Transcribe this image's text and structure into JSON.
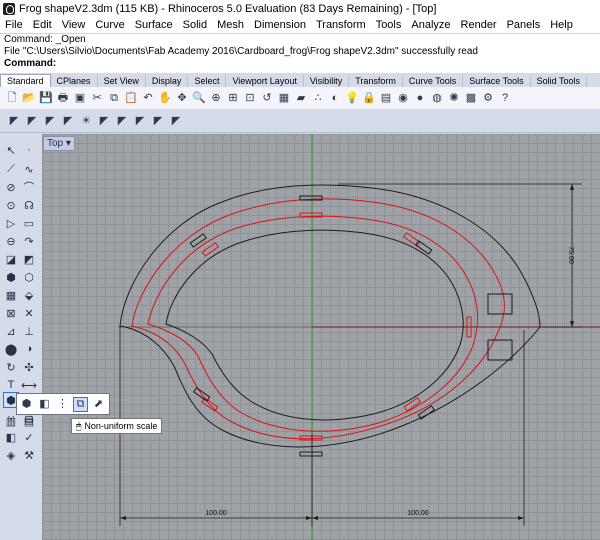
{
  "window": {
    "title": "Frog shapeV2.3dm (115 KB) - Rhinoceros 5.0 Evaluation (83 Days Remaining) - [Top]"
  },
  "menu": [
    "File",
    "Edit",
    "View",
    "Curve",
    "Surface",
    "Solid",
    "Mesh",
    "Dimension",
    "Transform",
    "Tools",
    "Analyze",
    "Render",
    "Panels",
    "Help"
  ],
  "command_history": [
    "Command: _Open",
    "File \"C:\\Users\\Silvio\\Documents\\Fab Academy 2016\\Cardboard_frog\\Frog shapeV2.3dm\" successfully read"
  ],
  "command_prompt": "Command:",
  "toolbar_tabs": [
    "Standard",
    "CPlanes",
    "Set View",
    "Display",
    "Select",
    "Viewport Layout",
    "Visibility",
    "Transform",
    "Curve Tools",
    "Surface Tools",
    "Solid Tools"
  ],
  "active_tab": "Standard",
  "viewport": {
    "label": "Top ▾"
  },
  "tooltip": {
    "text": "Non-uniform scale"
  },
  "dimensions": {
    "bottom_left": "100.00",
    "bottom_right": "100.00",
    "right_vertical": "75.00"
  },
  "colors": {
    "viewport_bg": "#9fa2a6",
    "grid": "#8f9296",
    "curve_black": "#1b1b1b",
    "curve_red": "#d81515",
    "axis_green": "#19a019",
    "axis_red": "#8a1a1a"
  }
}
